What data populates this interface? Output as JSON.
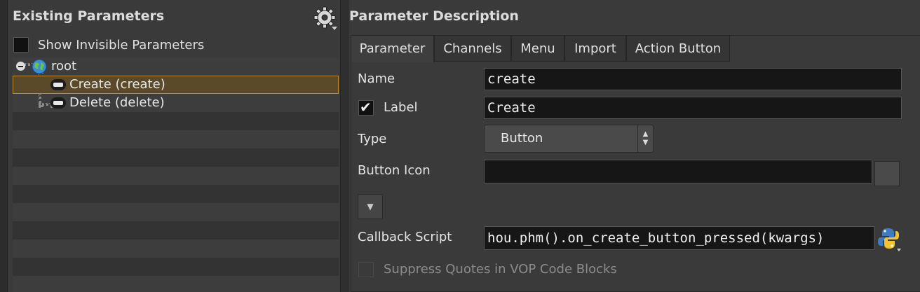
{
  "left_panel": {
    "title": "Existing Parameters",
    "show_invisible_label": "Show Invisible Parameters",
    "show_invisible_checked": false,
    "tree": {
      "root_label": "root",
      "items": [
        {
          "label": "Create (create)",
          "selected": true
        },
        {
          "label": "Delete (delete)",
          "selected": false
        }
      ]
    }
  },
  "right_panel": {
    "title": "Parameter Description",
    "tabs": [
      {
        "label": "Parameter",
        "active": true
      },
      {
        "label": "Channels",
        "active": false
      },
      {
        "label": "Menu",
        "active": false
      },
      {
        "label": "Import",
        "active": false
      },
      {
        "label": "Action Button",
        "active": false
      }
    ],
    "fields": {
      "name_label": "Name",
      "name_value": "create",
      "label_label": "Label",
      "label_checked": true,
      "label_value": "Create",
      "type_label": "Type",
      "type_value": "Button",
      "button_icon_label": "Button Icon",
      "button_icon_value": "",
      "callback_label": "Callback Script",
      "callback_value": "hou.phm().on_create_button_pressed(kwargs)",
      "suppress_quotes_label": "Suppress Quotes in VOP Code Blocks",
      "suppress_quotes_checked": false
    }
  },
  "icons": {
    "gear": "gear-icon",
    "globe": "globe-icon",
    "button": "button-icon",
    "python": "python-icon",
    "expand": "chevron-down-icon",
    "check": "checkmark-icon"
  },
  "colors": {
    "background": "#3a3a3a",
    "selection_fill": "#5a4a2a",
    "selection_outline": "#c08a30",
    "field_bg": "#161616"
  }
}
